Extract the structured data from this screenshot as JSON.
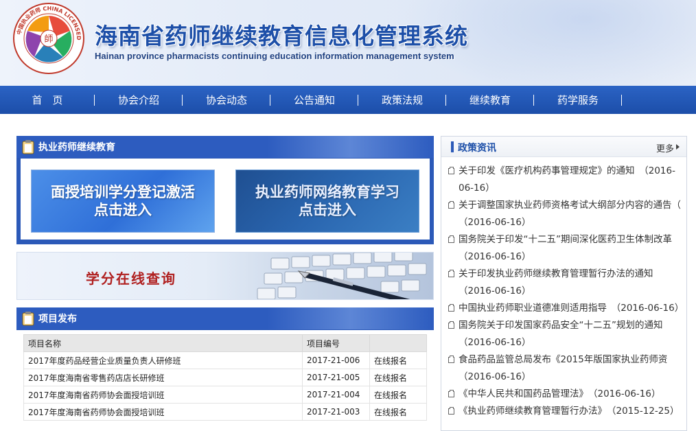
{
  "header": {
    "title": "海南省药师继续教育信息化管理系统",
    "subtitle": "Hainan province pharmacists continuing education information management system",
    "logo_text": "中国执业药师 CHINA LICENSED PHARMACIST",
    "logo_center": "師"
  },
  "nav": [
    "首　页",
    "协会介绍",
    "协会动态",
    "公告通知",
    "政策法规",
    "继续教育",
    "药学服务"
  ],
  "edu_panel": {
    "title": "执业药师继续教育",
    "button_a": {
      "line1": "面授培训学分登记激活",
      "line2": "点击进入"
    },
    "button_b": {
      "line1": "执业药师网络教育学习",
      "line2": "点击进入"
    }
  },
  "credit_banner": "学分在线查询",
  "project_panel": {
    "title": "项目发布",
    "columns": [
      "项目名称",
      "项目编号",
      ""
    ],
    "rows": [
      {
        "name": "2017年度药品经营企业质量负责人研修班",
        "code": "2017-21-006",
        "action": "在线报名"
      },
      {
        "name": "2017年度海南省零售药店店长研修班",
        "code": "2017-21-005",
        "action": "在线报名"
      },
      {
        "name": "2017年度海南省药师协会面授培训班",
        "code": "2017-21-004",
        "action": "在线报名"
      },
      {
        "name": "2017年度海南省药师协会面授培训班",
        "code": "2017-21-003",
        "action": "在线报名"
      }
    ]
  },
  "news": {
    "title": "政策资讯",
    "more": "更多",
    "items": [
      "关于印发《医疗机构药事管理规定》的通知　（2016-06-16）",
      "关于调整国家执业药师资格考试大纲部分内容的通告（　（2016-06-16）",
      "国务院关于印发“十二五”期间深化医药卫生体制改革　（2016-06-16）",
      "关于印发执业药师继续教育管理暂行办法的通知　（2016-06-16）",
      "中国执业药师职业道德准则适用指导　（2016-06-16）",
      "国务院关于印发国家药品安全“十二五”规划的通知　（2016-06-16）",
      "食品药品监管总局发布《2015年版国家执业药师资　（2016-06-16）",
      "《中华人民共和国药品管理法》　（2016-06-16）",
      "《执业药师继续教育管理暂行办法》　（2015-12-25）"
    ]
  },
  "colors": {
    "nav_bg": "#1c4ea9",
    "panel_blue": "#2b59b8",
    "title_blue": "#1d4fa8",
    "credit_red": "#b02020"
  }
}
